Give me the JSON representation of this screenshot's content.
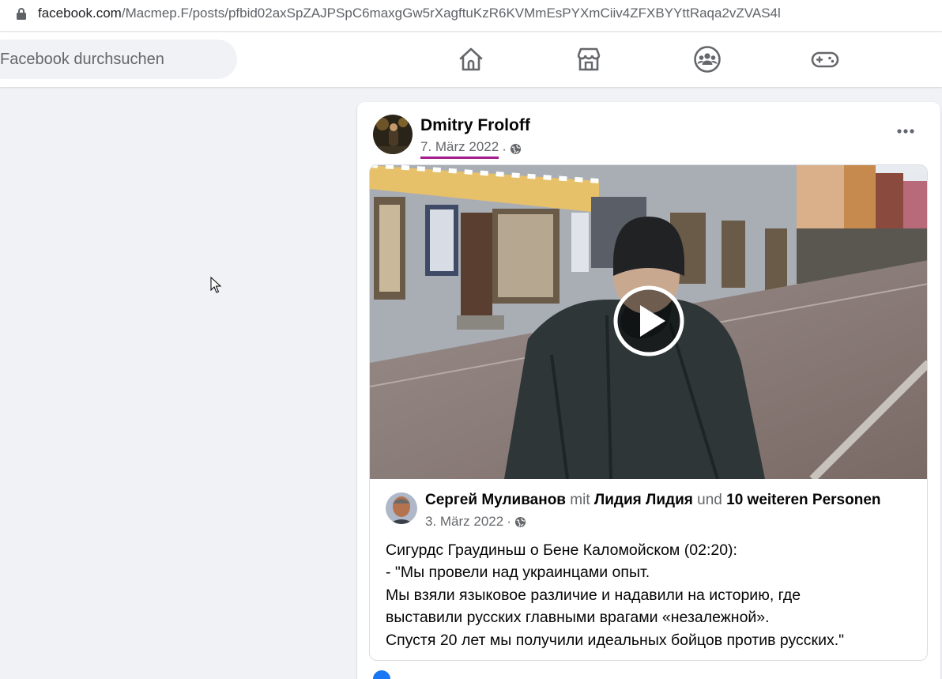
{
  "browser": {
    "url_domain": "facebook.com",
    "url_path": "/Macmep.F/posts/pfbid02axSpZAJPSpC6maxgGw5rXagftuKzR6KVMmEsPYXmCiiv4ZFXBYYttRaqa2vZVAS4l"
  },
  "header": {
    "search_placeholder": "Facebook durchsuchen",
    "nav_icons": [
      "home-icon",
      "marketplace-icon",
      "groups-icon",
      "gaming-icon"
    ]
  },
  "post": {
    "author": "Dmitry Froloff",
    "date": "7. März 2022",
    "separator": "·",
    "audience_icon": "globe-icon",
    "shared": {
      "author": "Сергей Муливанов",
      "with_word": "mit",
      "tagged": "Лидия Лидия",
      "and_word": "und",
      "others": "10 weiteren Personen",
      "date": "3. März 2022",
      "separator": "·",
      "text_lines": [
        "Сигурдс Граудиньш о Бене Каломойском (02:20):",
        "- \"Мы провели над украинцами опыт.",
        "Мы взяли языковое различие и надавили на историю, где",
        "выставили русских главными врагами «незалежной».",
        "Спустя 20 лет мы получили идеальных бойцов против русских.\""
      ]
    }
  },
  "colors": {
    "accent": "#1877f2",
    "underline": "#a21c8f",
    "background": "#f0f2f5"
  }
}
